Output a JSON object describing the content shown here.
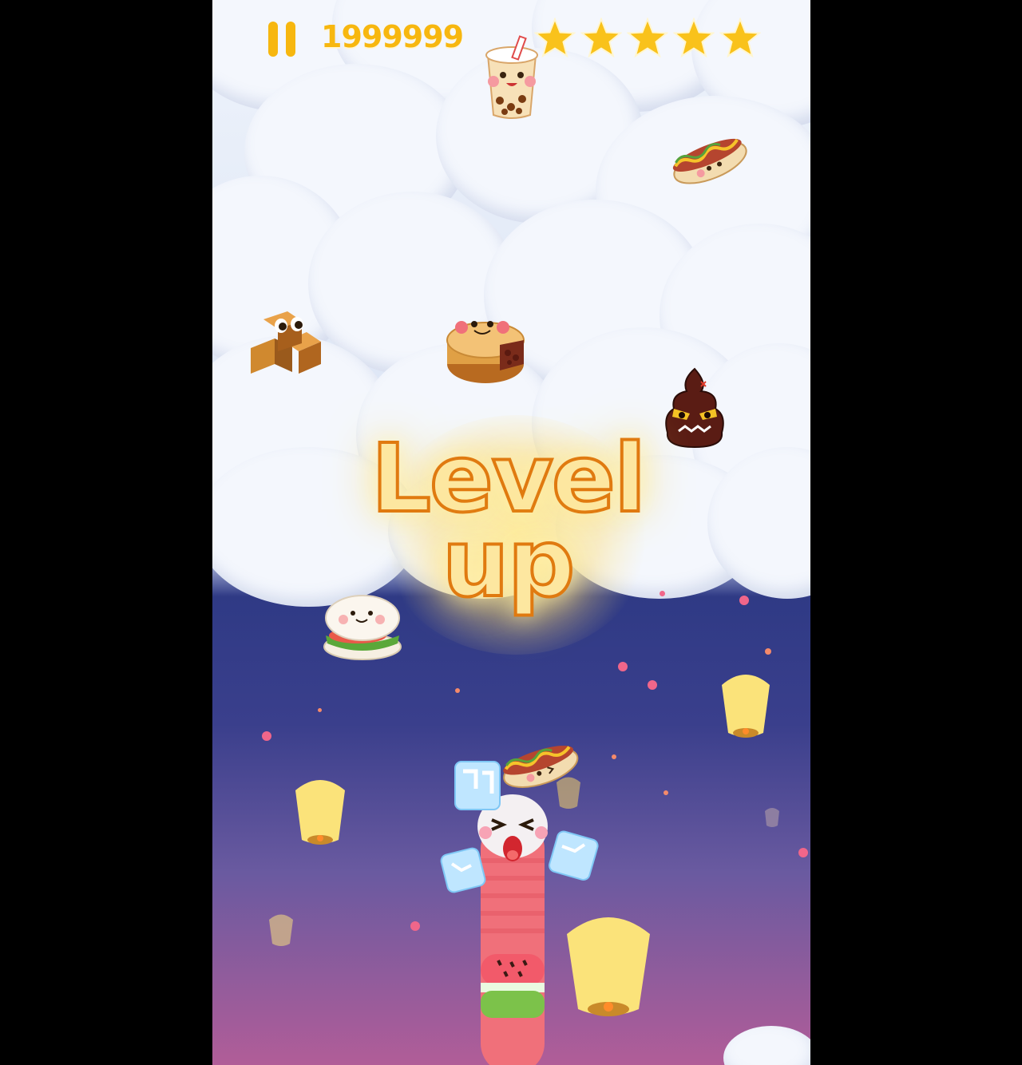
{
  "hud": {
    "pause_icon": "pause-icon",
    "score": "1999999",
    "stars_earned": 5,
    "stars_total": 5,
    "star_color": "#f9c21b"
  },
  "banner": {
    "line1": "Level",
    "line2": "up"
  },
  "colors": {
    "hud_accent": "#f7b70f",
    "banner_fill": "#fde7a0",
    "banner_outline": "#e07a10",
    "sky_top": "#eef3fb",
    "sky_night": "#2f3a85",
    "sky_bottom": "#b15d98"
  },
  "scene": {
    "items": [
      "bubble-tea-icon",
      "hotdog-icon",
      "fudge-icon",
      "mooncake-icon",
      "angry-poop-icon",
      "bun-icon",
      "ice-cube-icon",
      "hotdog-icon"
    ],
    "player": "watermelon-snake"
  }
}
